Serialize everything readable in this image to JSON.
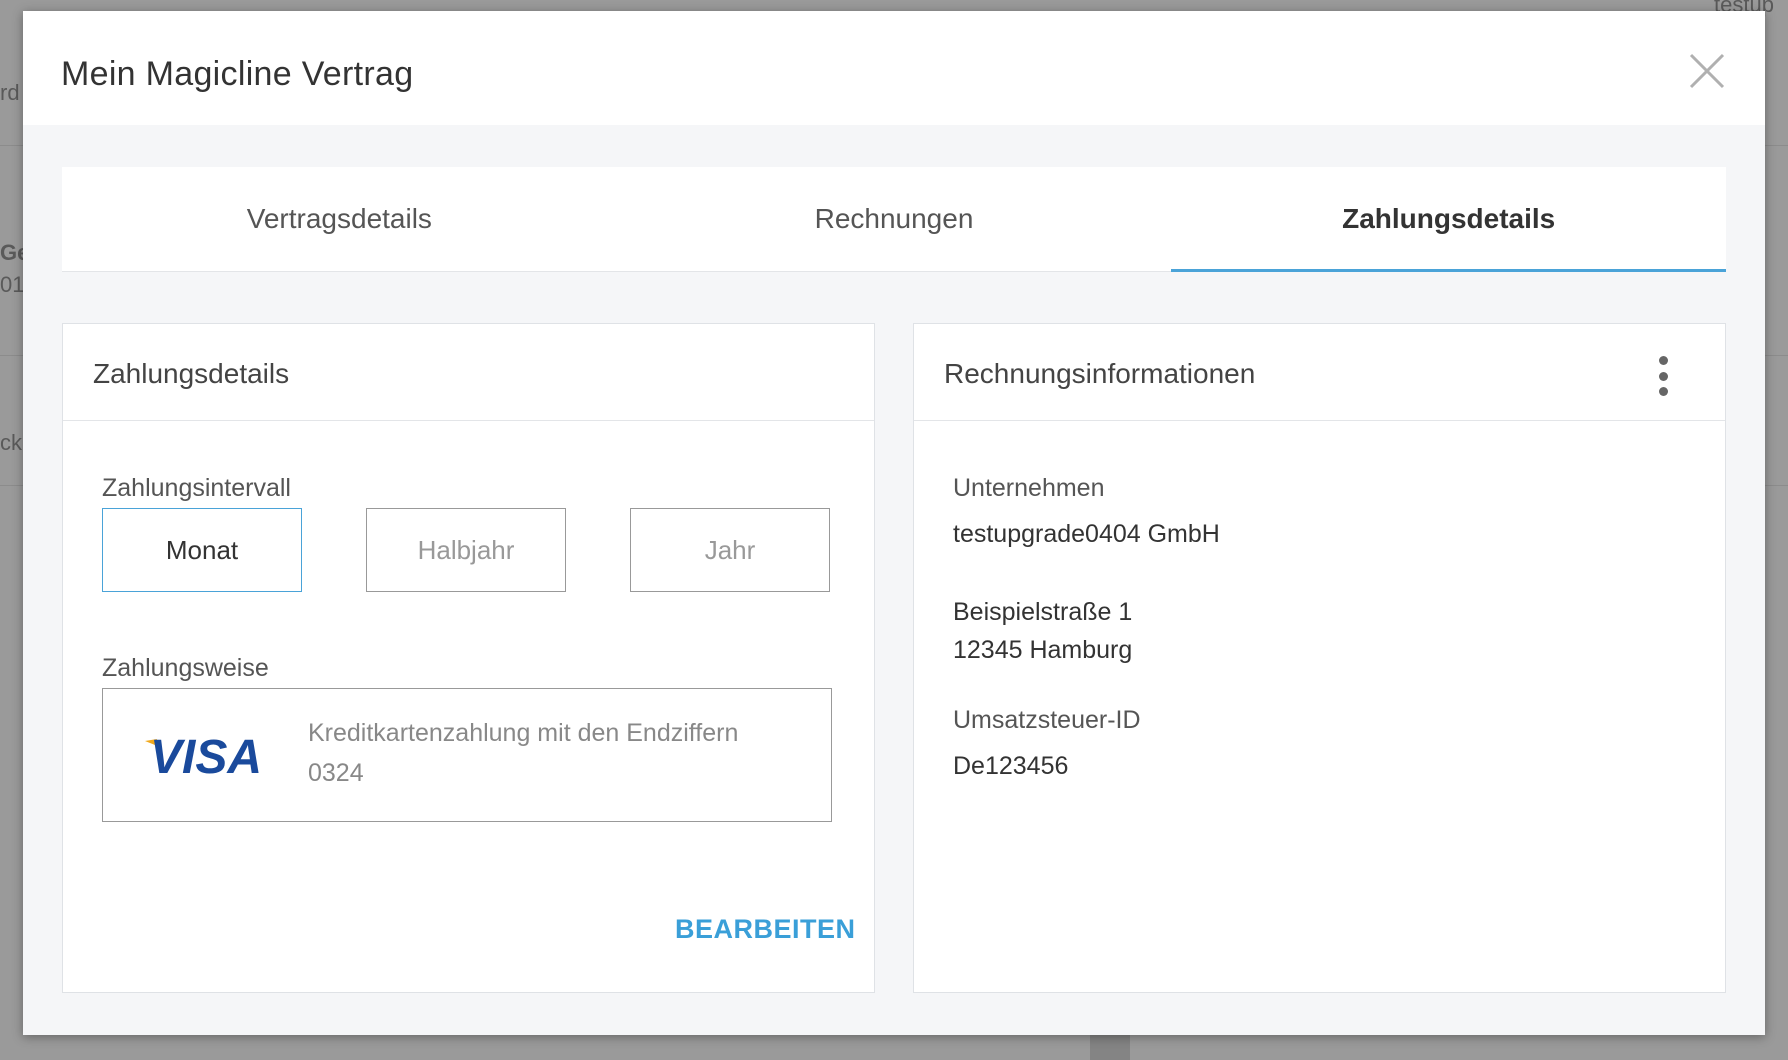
{
  "modal": {
    "title": "Mein Magicline Vertrag"
  },
  "background": {
    "fragment_1": "rd",
    "fragment_2": "Ge",
    "fragment_3": "01",
    "fragment_4": "ck",
    "fragment_5": "testup"
  },
  "tabs": [
    {
      "label": "Vertragsdetails",
      "active": false
    },
    {
      "label": "Rechnungen",
      "active": false
    },
    {
      "label": "Zahlungsdetails",
      "active": true
    }
  ],
  "payment_card": {
    "title": "Zahlungsdetails",
    "interval_label": "Zahlungsintervall",
    "intervals": [
      {
        "label": "Monat",
        "selected": true
      },
      {
        "label": "Halbjahr",
        "selected": false
      },
      {
        "label": "Jahr",
        "selected": false
      }
    ],
    "method_label": "Zahlungsweise",
    "card_brand": "VISA",
    "method_text": "Kreditkartenzahlung mit den Endziffern",
    "card_last_digits": "0324",
    "edit_label": "BEARBEITEN"
  },
  "invoice_card": {
    "title": "Rechnungsinformationen",
    "company_label": "Unternehmen",
    "company_value": "testupgrade0404 GmbH",
    "street": "Beispielstraße 1",
    "city": "12345 Hamburg",
    "vat_label": "Umsatzsteuer-ID",
    "vat_value": "De123456"
  },
  "colors": {
    "accent": "#4aa3d8",
    "visa_blue": "#1a4a9c",
    "visa_gold": "#f0a81c"
  }
}
